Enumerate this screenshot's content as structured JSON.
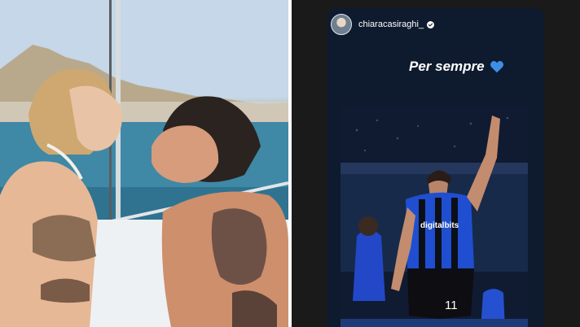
{
  "story": {
    "username": "chiaracasiraghi_",
    "caption": "Per sempre",
    "player_number": "11",
    "sponsor": "digitalbits"
  },
  "icons": {
    "verified": "verified-badge-icon",
    "heart": "blue-heart-icon"
  },
  "colors": {
    "heart": "#3d8fe6",
    "background": "#1a1a1b",
    "jersey_blue": "#1f4fd0"
  }
}
